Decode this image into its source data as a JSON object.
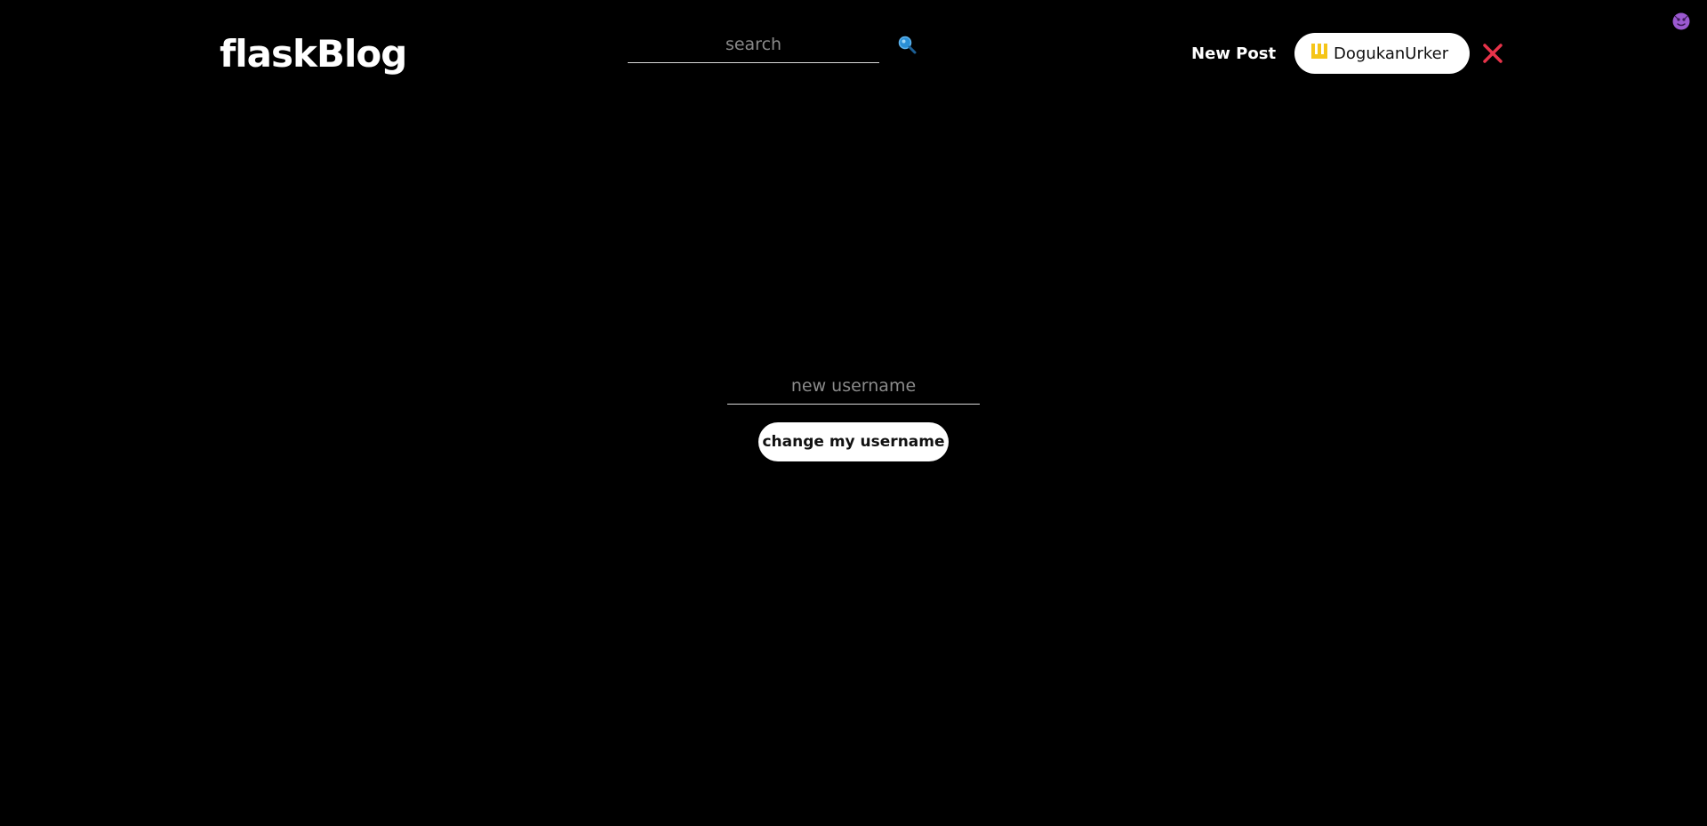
{
  "navbar": {
    "brand": "flaskBlog",
    "search": {
      "placeholder": "search",
      "value": "",
      "icon": "search-icon"
    },
    "new_post_label": "New Post",
    "user": {
      "username": "DogukanUrker",
      "badge_icon": "crown-icon"
    },
    "logout_icon": "close-icon",
    "theme_icon": "theme-toggle-icon"
  },
  "form": {
    "username_placeholder": "new username",
    "username_value": "",
    "submit_label": "change my username"
  },
  "colors": {
    "background": "#000000",
    "text": "#ffffff",
    "pill_background": "#ffffff",
    "crown": "#f5c518",
    "close": "#e8334a",
    "search_icon": "#2a8fd6",
    "theme_icon": "#9b59d0"
  }
}
